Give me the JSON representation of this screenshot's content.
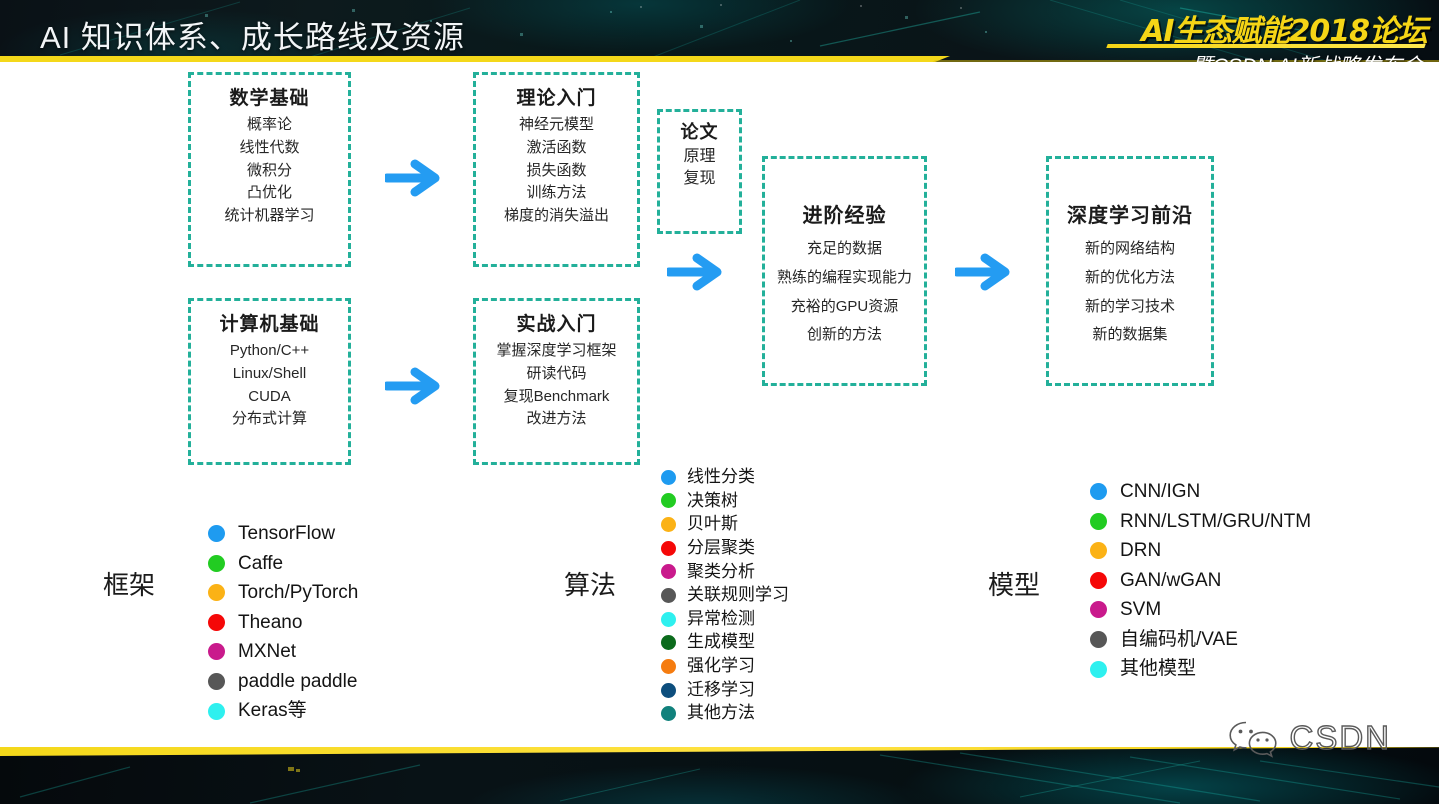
{
  "header": {
    "title": "AI 知识体系、成长路线及资源",
    "logo_main": "AI生态赋能2018论坛",
    "logo_sub": "暨CSDN AI新战略发布会"
  },
  "colors": {
    "box_border": "#23b09a",
    "arrow": "#249cf2",
    "header_bg": "#0a1418",
    "accent_yellow": "#f4d81a"
  },
  "boxes": [
    {
      "id": "math-foundation",
      "title": "数学基础",
      "items": [
        "概率论",
        "线性代数",
        "微积分",
        "凸优化",
        "统计机器学习"
      ]
    },
    {
      "id": "computer-foundation",
      "title": "计算机基础",
      "items": [
        "Python/C++",
        "Linux/Shell",
        "CUDA",
        "分布式计算"
      ]
    },
    {
      "id": "theory-intro",
      "title": "理论入门",
      "items": [
        "神经元模型",
        "激活函数",
        "损失函数",
        "训练方法",
        "梯度的消失溢出"
      ]
    },
    {
      "id": "practice-intro",
      "title": "实战入门",
      "items": [
        "掌握深度学习框架",
        "研读代码",
        "复现Benchmark",
        "改进方法"
      ]
    },
    {
      "id": "paper",
      "title": "论文",
      "items": [
        "原理",
        "复现"
      ]
    },
    {
      "id": "advanced-experience",
      "title": "进阶经验",
      "items": [
        "充足的数据",
        "熟练的编程实现能力",
        "充裕的GPU资源",
        "创新的方法"
      ]
    },
    {
      "id": "deep-learning-frontier",
      "title": "深度学习前沿",
      "items": [
        "新的网络结构",
        "新的优化方法",
        "新的学习技术",
        "新的数据集"
      ]
    }
  ],
  "legends": [
    {
      "id": "frameworks",
      "title": "框架",
      "items": [
        {
          "label": "TensorFlow",
          "color": "#1e9bf0"
        },
        {
          "label": "Caffe",
          "color": "#22cc22"
        },
        {
          "label": "Torch/PyTorch",
          "color": "#fbb216"
        },
        {
          "label": "Theano",
          "color": "#f50808"
        },
        {
          "label": "MXNet",
          "color": "#c91a8c"
        },
        {
          "label": "paddle paddle",
          "color": "#575757"
        },
        {
          "label": "Keras等",
          "color": "#2ef0ef"
        }
      ]
    },
    {
      "id": "algorithms",
      "title": "算法",
      "items": [
        {
          "label": "线性分类",
          "color": "#1e9bf0"
        },
        {
          "label": "决策树",
          "color": "#22cc22"
        },
        {
          "label": "贝叶斯",
          "color": "#fbb216"
        },
        {
          "label": "分层聚类",
          "color": "#f50808"
        },
        {
          "label": "聚类分析",
          "color": "#c91a8c"
        },
        {
          "label": "关联规则学习",
          "color": "#575757"
        },
        {
          "label": "异常检测",
          "color": "#2ef0ef"
        },
        {
          "label": "生成模型",
          "color": "#0b6b1c"
        },
        {
          "label": "强化学习",
          "color": "#f57c10"
        },
        {
          "label": "迁移学习",
          "color": "#0d4e7d"
        },
        {
          "label": "其他方法",
          "color": "#11817c"
        }
      ]
    },
    {
      "id": "models",
      "title": "模型",
      "items": [
        {
          "label": "CNN/IGN",
          "color": "#1e9bf0"
        },
        {
          "label": "RNN/LSTM/GRU/NTM",
          "color": "#22cc22"
        },
        {
          "label": "DRN",
          "color": "#fbb216"
        },
        {
          "label": "GAN/wGAN",
          "color": "#f50808"
        },
        {
          "label": "SVM",
          "color": "#c91a8c"
        },
        {
          "label": "自编码机/VAE",
          "color": "#575757"
        },
        {
          "label": "其他模型",
          "color": "#2ef0ef"
        }
      ]
    }
  ],
  "footer": {
    "brand": "CSDN"
  }
}
